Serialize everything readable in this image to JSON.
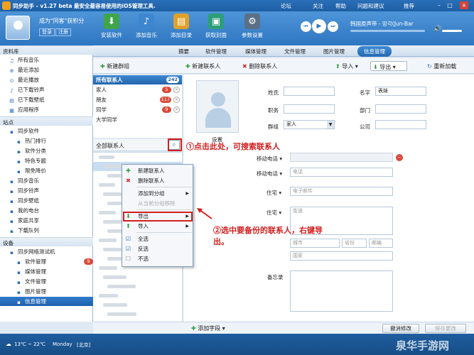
{
  "titlebar": {
    "title": "同步助手 - v1.27 beta  最安全最容易使用的iOS管理工具.",
    "menus": [
      "论坛",
      "关注",
      "帮助",
      "问题和建议",
      "推荐"
    ]
  },
  "user": {
    "name": "成为\"同客\"获积分",
    "login": "登录",
    "register": "注册"
  },
  "toolbar": [
    {
      "label": "安装软件",
      "icon": "install-icon",
      "color": "#3fa54a",
      "glyph": "⬇"
    },
    {
      "label": "添加音乐",
      "icon": "music-icon",
      "color": "#3d86d0",
      "glyph": "♪"
    },
    {
      "label": "添加目录",
      "icon": "folder-icon",
      "color": "#e0a12a",
      "glyph": "▤"
    },
    {
      "label": "获取封面",
      "icon": "cover-icon",
      "color": "#2e9e7a",
      "glyph": "▣"
    },
    {
      "label": "参数设置",
      "icon": "gear-icon",
      "color": "#5b6f86",
      "glyph": "⚙"
    }
  ],
  "player": {
    "song": "韩国原声带 - 망각(Jun-Bar",
    "prev": "⏮",
    "play": "▶",
    "next": "⏭"
  },
  "tabs": [
    "摘要",
    "软件管理",
    "媒体管理",
    "文件管理",
    "图片管理",
    "信息管理"
  ],
  "sidebar": {
    "library_header": "资料库",
    "library": [
      "所有音乐",
      "最近添加",
      "最近播放",
      "已下载铃声",
      "已下载壁纸",
      "应用程序"
    ],
    "site_header": "站点",
    "site": [
      "同步软件",
      "热门排行",
      "软件分类",
      "特色专题",
      "限免降价",
      "同步音乐",
      "同步铃声",
      "同步壁纸",
      "我的电台",
      "家庭共享",
      "下载队列"
    ],
    "device_header": "设备",
    "device": [
      "同步网络测试机",
      "软件管理",
      "媒体管理",
      "文件管理",
      "图片管理",
      "信息管理"
    ],
    "device_badge": "9"
  },
  "contacts_toolbar": {
    "new_group": "新建群组",
    "new_contact": "新建联系人",
    "delete_contact": "删除联系人",
    "import": "导入",
    "export": "导出",
    "reload": "重新加载"
  },
  "groups": [
    {
      "name": "所有联系人",
      "count": "242"
    },
    {
      "name": "家人",
      "count": "5"
    },
    {
      "name": "朋友",
      "count": "117"
    },
    {
      "name": "同学",
      "count": "9"
    },
    {
      "name": "大学同学",
      "count": ""
    }
  ],
  "search_label": "全部联系人",
  "context_menu": [
    "新建联系人",
    "删除联系人",
    "添加到分组",
    "从当前分组移除",
    "导出",
    "导入",
    "全选",
    "反选",
    "不选"
  ],
  "form": {
    "avatar_label": "设置",
    "lastname": "姓氏",
    "firstname": "名字",
    "firstname_value": "表妹",
    "title": "职务",
    "department": "部门",
    "group": "群组",
    "group_value": "家人",
    "company": "公司",
    "mobile": "移动电话",
    "phone_ph": "电话",
    "home": "住宅",
    "email_ph": "电子邮件",
    "address": "住宅",
    "street_ph": "街道",
    "city_ph": "城市",
    "province_ph": "省份",
    "zip_ph": "邮编",
    "country_ph": "国家",
    "note": "备忘录",
    "add_field": "添加字段",
    "cancel": "撤消修改",
    "save": "保存更改"
  },
  "annotations": {
    "a1": "①点击此处，可搜索联系人",
    "a2": "②选中要备份的联系人，右键导",
    "a2b": "出。"
  },
  "status": {
    "weather": "13℃ ~ 22℃",
    "day": "Monday",
    "city": "[北京]"
  },
  "watermark": "泉华手游网"
}
